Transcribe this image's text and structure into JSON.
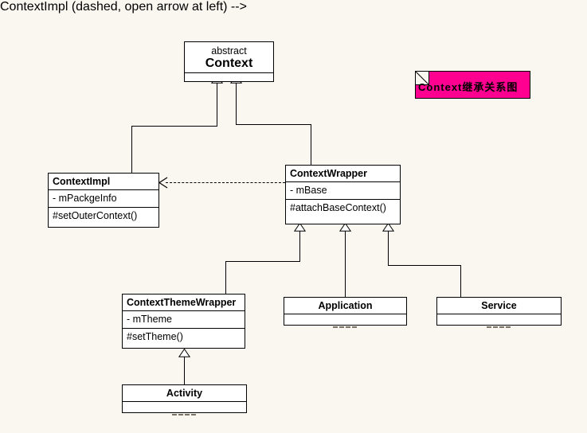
{
  "diagram": {
    "title_note": {
      "text": "Context继承关系图",
      "color": "#ff0090"
    },
    "background_color": "#faf7f0",
    "line_color": "#000000",
    "classes": [
      {
        "id": "context",
        "stereotype": "abstract",
        "name": "Context",
        "attributes": [],
        "operations": [],
        "empty_compartment": true
      },
      {
        "id": "context-impl",
        "stereotype": "",
        "name": "ContextImpl",
        "attributes": [
          "- mPackgeInfo"
        ],
        "operations": [
          "#setOuterContext()"
        ],
        "empty_compartment": false
      },
      {
        "id": "context-wrapper",
        "stereotype": "",
        "name": "ContextWrapper",
        "attributes": [
          "- mBase"
        ],
        "operations": [
          "#attachBaseContext()"
        ],
        "empty_compartment": false
      },
      {
        "id": "context-theme-wrapper",
        "stereotype": "",
        "name": "ContextThemeWrapper",
        "attributes": [
          "- mTheme"
        ],
        "operations": [
          "#setTheme()"
        ],
        "empty_compartment": false
      },
      {
        "id": "application",
        "stereotype": "",
        "name": "Application",
        "attributes": [],
        "operations": [],
        "empty_compartment": true
      },
      {
        "id": "service",
        "stereotype": "",
        "name": "Service",
        "attributes": [],
        "operations": [],
        "empty_compartment": true
      },
      {
        "id": "activity",
        "stereotype": "",
        "name": "Activity",
        "attributes": [],
        "operations": [],
        "empty_compartment": true
      }
    ],
    "relationships": [
      {
        "type": "generalization",
        "from": "ContextImpl",
        "to": "Context"
      },
      {
        "type": "generalization",
        "from": "ContextWrapper",
        "to": "Context"
      },
      {
        "type": "dependency",
        "from": "ContextWrapper",
        "to": "ContextImpl"
      },
      {
        "type": "generalization",
        "from": "ContextThemeWrapper",
        "to": "ContextWrapper"
      },
      {
        "type": "generalization",
        "from": "Application",
        "to": "ContextWrapper"
      },
      {
        "type": "generalization",
        "from": "Service",
        "to": "ContextWrapper"
      },
      {
        "type": "generalization",
        "from": "Activity",
        "to": "ContextThemeWrapper"
      }
    ]
  }
}
